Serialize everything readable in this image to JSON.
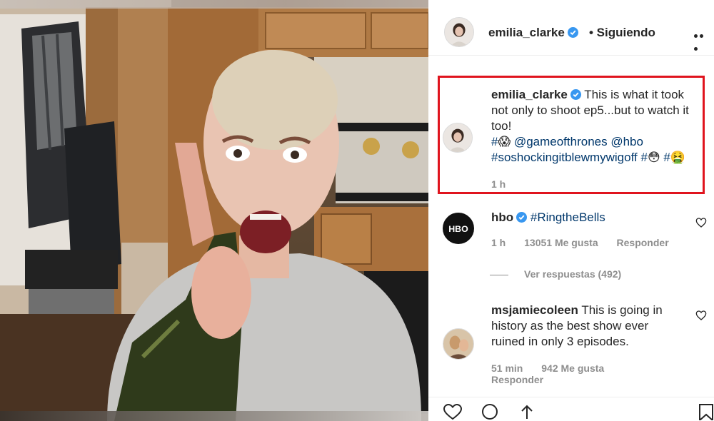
{
  "post": {
    "author": "emilia_clarke",
    "follow_status": "• Siguiendo",
    "photo_icon": "woman-with-bottle-photo"
  },
  "caption": {
    "username": "emilia_clarke",
    "line1": "This is what it took",
    "line2": "not only to shoot ep5...but to watch it",
    "line3": "too!",
    "line4_hash": "#",
    "line4_emoji": "😱",
    "mention1": "@gameofthrones",
    "mention2": "@hbo",
    "hashtag": "#soshockingitblewmywigoff",
    "hash2": "#",
    "emoji2": "😳",
    "hash3": "#",
    "emoji3": "🤮",
    "time": "1 h"
  },
  "comments": [
    {
      "username": "hbo",
      "text": "#RingtheBells",
      "time": "1 h",
      "likes": "13051 Me gusta",
      "reply": "Responder",
      "view_replies": "Ver respuestas (492)"
    },
    {
      "username": "msjamiecoleen",
      "text1": "This is going in",
      "text2": "history as the best show ever",
      "text3": "ruined in only 3 episodes.",
      "time": "51 min",
      "likes": "942 Me gusta",
      "reply": "Responder"
    }
  ],
  "colors": {
    "highlight_border": "#e0141e",
    "verified_blue": "#3897f0",
    "link_blue": "#00376b",
    "meta_gray": "#8e8e8e"
  }
}
